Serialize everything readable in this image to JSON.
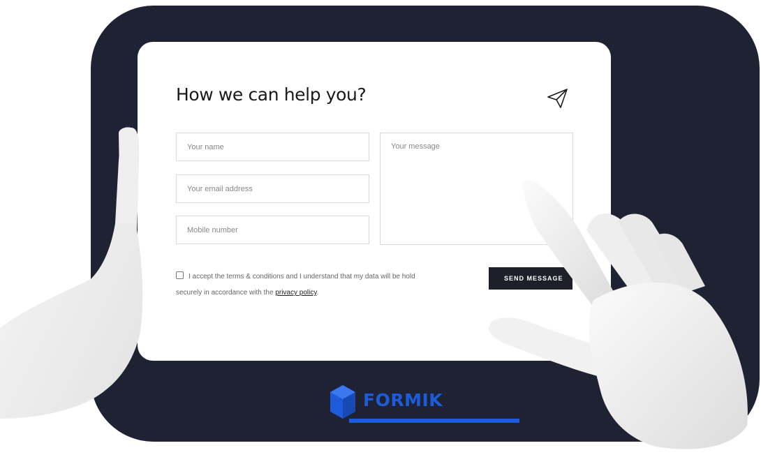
{
  "form": {
    "title": "How we can help you?",
    "name_placeholder": "Your name",
    "email_placeholder": "Your email address",
    "mobile_placeholder": "Mobile number",
    "message_placeholder": "Your message",
    "consent_text": "I accept the terms & conditions and I understand that my data will be hold securely in accordance with the",
    "privacy_link": "privacy policy",
    "consent_end": ".",
    "submit_label": "SEND MESSAGE",
    "send_icon": "paper-plane-icon"
  },
  "brand": {
    "name": "FORMIK",
    "color": "#1e5bd8",
    "icon": "cube-icon"
  },
  "colors": {
    "device": "#1f2233",
    "button": "#1d1f29"
  }
}
